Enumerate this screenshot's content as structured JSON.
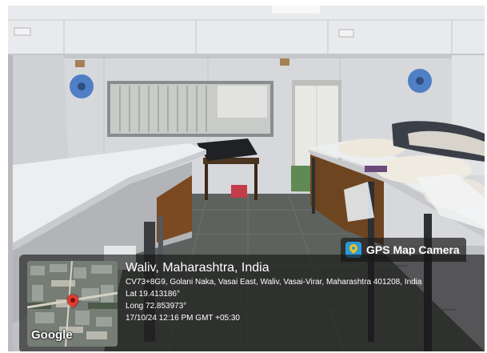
{
  "overlay": {
    "app_name": "GPS Map Camera",
    "app_icon": "map-pin-camera-icon",
    "map_logo": "Google",
    "place_title": "Waliv, Maharashtra, India",
    "address": "CV73+8G9, Golani Naka, Vasai East, Waliv, Vasai-Virar, Maharashtra 401208, India",
    "latitude": "Lat 19.413186°",
    "longitude": "Long 72.853973°",
    "datetime": "17/10/24 12:16 PM GMT +05:30"
  },
  "colors": {
    "panel": "#141414",
    "pin": "#e23b31",
    "app_icon_bg": "#2d9ad8"
  }
}
